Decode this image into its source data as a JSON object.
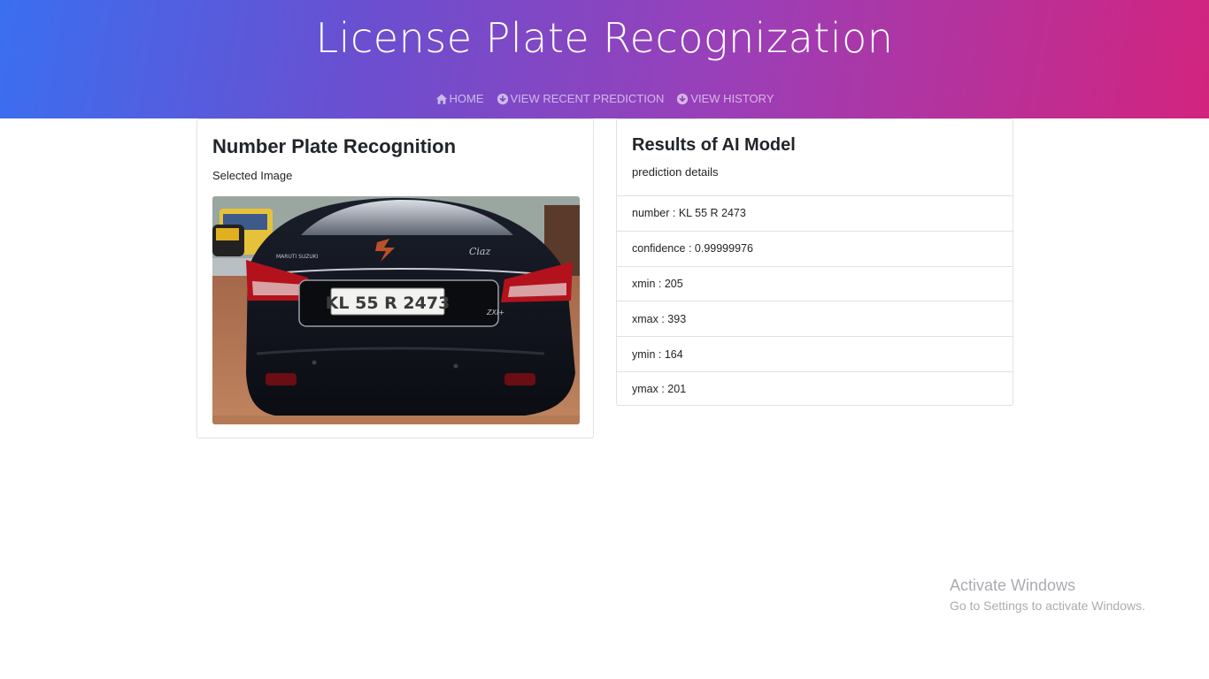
{
  "header": {
    "title": "License Plate Recognization",
    "nav": [
      {
        "label": "HOME",
        "icon": "home-icon"
      },
      {
        "label": "VIEW RECENT PREDICTION",
        "icon": "arrow-circle-down-icon"
      },
      {
        "label": "VIEW HISTORY",
        "icon": "arrow-circle-down-icon"
      }
    ]
  },
  "left_card": {
    "title": "Number Plate Recognition",
    "subtitle": "Selected Image",
    "image": {
      "plate_text": "KL 55 R 2473",
      "brand_text": "MARUTI SUZUKI",
      "model_text": "Ciaz",
      "trim_text": "ZXI+"
    }
  },
  "right_card": {
    "title": "Results of AI Model",
    "subtitle": "prediction details",
    "results": [
      {
        "key": "number",
        "value": "KL 55 R 2473"
      },
      {
        "key": "confidence",
        "value": "0.99999976"
      },
      {
        "key": "xmin",
        "value": "205"
      },
      {
        "key": "xmax",
        "value": "393"
      },
      {
        "key": "ymin",
        "value": "164"
      },
      {
        "key": "ymax",
        "value": "201"
      }
    ]
  },
  "watermark": {
    "title": "Activate Windows",
    "subtitle": "Go to Settings to activate Windows."
  },
  "colors": {
    "gradient_start": "#3a6ff0",
    "gradient_end": "#d2247e",
    "card_border": "#dfe1e5",
    "text": "#212529"
  }
}
